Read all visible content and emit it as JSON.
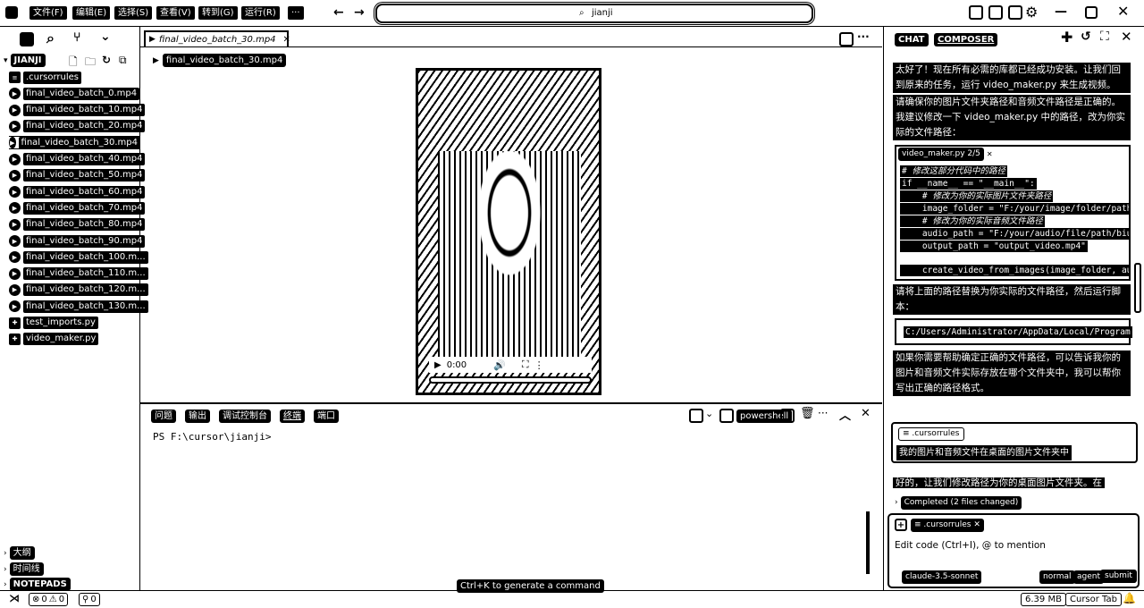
{
  "titlebar": {
    "menu": [
      "文件(F)",
      "编辑(E)",
      "选择(S)",
      "查看(V)",
      "转到(G)",
      "运行(R)",
      "···"
    ],
    "search_text": "jianji"
  },
  "explorer": {
    "section_title": "JIANJI",
    "files": [
      {
        "name": ".cursorrules",
        "icon": "list-icon"
      },
      {
        "name": "final_video_batch_0.mp4",
        "icon": "play-icon"
      },
      {
        "name": "final_video_batch_10.mp4",
        "icon": "play-icon"
      },
      {
        "name": "final_video_batch_20.mp4",
        "icon": "play-icon"
      },
      {
        "name": "final_video_batch_30.mp4",
        "icon": "play-icon"
      },
      {
        "name": "final_video_batch_40.mp4",
        "icon": "play-icon"
      },
      {
        "name": "final_video_batch_50.mp4",
        "icon": "play-icon"
      },
      {
        "name": "final_video_batch_60.mp4",
        "icon": "play-icon"
      },
      {
        "name": "final_video_batch_70.mp4",
        "icon": "play-icon"
      },
      {
        "name": "final_video_batch_80.mp4",
        "icon": "play-icon"
      },
      {
        "name": "final_video_batch_90.mp4",
        "icon": "play-icon"
      },
      {
        "name": "final_video_batch_100.m...",
        "icon": "play-icon"
      },
      {
        "name": "final_video_batch_110.m...",
        "icon": "play-icon"
      },
      {
        "name": "final_video_batch_120.m...",
        "icon": "play-icon"
      },
      {
        "name": "final_video_batch_130.m...",
        "icon": "play-icon"
      },
      {
        "name": "test_imports.py",
        "icon": "python-icon"
      },
      {
        "name": "video_maker.py",
        "icon": "python-icon"
      }
    ],
    "bottom_sections": [
      "大纲",
      "时间线",
      "NOTEPADS"
    ]
  },
  "editor": {
    "tab_label": "final_video_batch_30.mp4",
    "breadcrumb": "final_video_batch_30.mp4",
    "video_time": "0:00"
  },
  "terminal": {
    "tabs": [
      "问题",
      "输出",
      "调试控制台",
      "终端",
      "端口"
    ],
    "shell_label": "powershell",
    "prompt": "PS F:\\cursor\\jianji>",
    "hint": "Ctrl+K to generate a command"
  },
  "chat": {
    "tabs": [
      "CHAT",
      "COMPOSER"
    ],
    "paragraph1": "太好了！现在所有必需的库都已经成功安装。让我们回到原来的任务，运行 video_maker.py 来生成视频。",
    "paragraph2": "请确保你的图片文件夹路径和音频文件路径是正确的。我建议修改一下 video_maker.py 中的路径，改为你实际的文件路径：",
    "code_file": "video_maker.py 2/5",
    "code_lines": [
      "# 修改这部分代码中的路径",
      "if __name__ == \"__main__\":",
      "    # 修改为你的实际图片文件夹路径",
      "    image_folder = \"F:/your/image/folder/path\"",
      "    # 修改为你的实际音频文件路径",
      "    audio_path = \"F:/your/audio/file/path/biub",
      "    output_path = \"output_video.mp4\"",
      "",
      "    create_video_from_images(image_folder, auc"
    ],
    "paragraph3": "请将上面的路径替换为你实际的文件路径，然后运行脚本：",
    "command": "C:/Users/Administrator/AppData/Local/Program",
    "paragraph4": "如果你需要帮助确定正确的文件路径，可以告诉我你的图片和音频文件实际存放在哪个文件夹中，我可以帮你写出正确的路径格式。",
    "user_chip": ".cursorrules",
    "user_message": "我的图片和音频文件在桌面的图片文件夹中",
    "reply_start": "好的，让我们修改路径为你的桌面图片文件夹。在",
    "completed": "Completed (2 files changed)",
    "input_chip": ".cursorrules",
    "input_placeholder": "Edit code (Ctrl+I), @ to mention",
    "model": "claude-3.5-sonnet",
    "mode_normal": "normal",
    "mode_agent": "agent",
    "submit": "submit"
  },
  "statusbar": {
    "errors": "0",
    "warnings": "0",
    "ports": "0",
    "memory": "6.39 MB",
    "cursor_tab": "Cursor Tab"
  }
}
